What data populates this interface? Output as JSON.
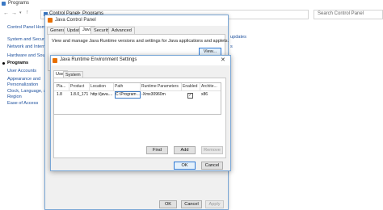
{
  "control_panel": {
    "title": "Programs",
    "breadcrumb": [
      "Control Panel",
      ">",
      "Programs"
    ],
    "search_placeholder": "Search Control Panel",
    "sidebar": [
      {
        "label": "Control Panel Home",
        "active": false
      },
      {
        "label": "System and Security",
        "active": false
      },
      {
        "label": "Network and Internet",
        "active": false
      },
      {
        "label": "Hardware and Sound",
        "active": false
      },
      {
        "label": "Programs",
        "active": true
      },
      {
        "label": "User Accounts",
        "active": false
      },
      {
        "label": "Appearance and",
        "active": false
      },
      {
        "label": "Personalization",
        "active": false
      },
      {
        "label": "Clock, Language, and",
        "active": false
      },
      {
        "label": "Region",
        "active": false
      },
      {
        "label": "Ease of Access",
        "active": false
      }
    ],
    "partial_link_1": "updates",
    "partial_link_2": "s"
  },
  "java_control_panel": {
    "title": "Java Control Panel",
    "tabs": [
      "General",
      "Update",
      "Java",
      "Security",
      "Advanced"
    ],
    "active_tab": "Java",
    "description": "View and manage Java Runtime versions and settings for Java applications and applets.",
    "view_button": "View..."
  },
  "jre_settings": {
    "title": "Java Runtime Environment Settings",
    "tabs": [
      "User",
      "System"
    ],
    "active_tab": "User",
    "columns": [
      "Pla...",
      "Product",
      "Location",
      "Path",
      "Runtime Parameters",
      "Enabled",
      "Archite..."
    ],
    "row": {
      "platform": "1.8",
      "product": "1.8.0_171",
      "location": "http://java....",
      "path": "C:\\Program ...",
      "runtime_parameters": "-Xmx30960m",
      "enabled": "✓",
      "architecture": "x86"
    },
    "buttons": {
      "find": "Find",
      "add": "Add",
      "remove": "Remove",
      "ok": "OK",
      "cancel": "Cancel"
    }
  },
  "jcp_buttons": {
    "ok": "OK",
    "cancel": "Cancel",
    "apply": "Apply"
  },
  "colors": {
    "accent": "#2f7ad6",
    "java_icon": "#e76f00",
    "link": "#1b4e9c"
  }
}
